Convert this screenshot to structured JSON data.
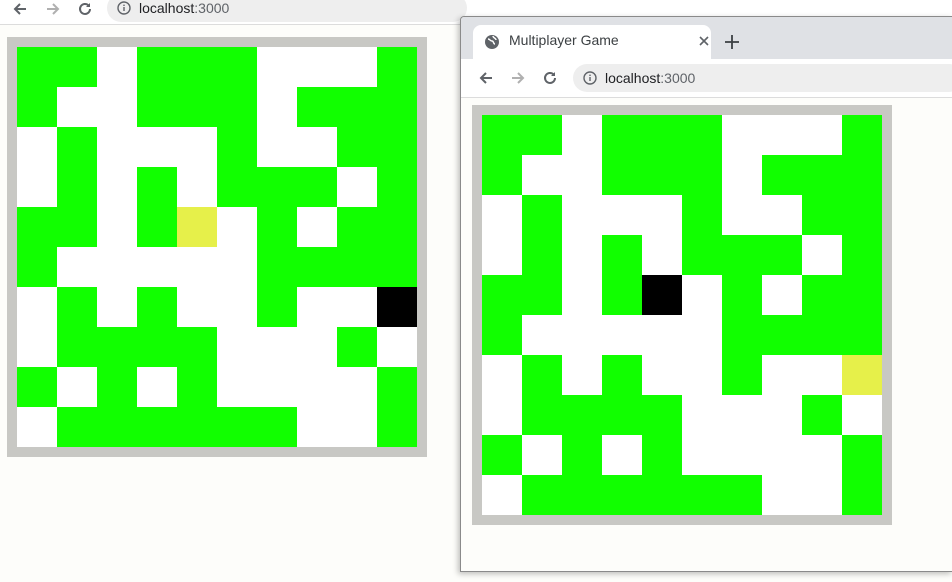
{
  "left_window": {
    "url_host": "localhost",
    "url_port": ":3000",
    "grid_rows": [
      "GGWGGGWWWG",
      "GWWGGGWGGG",
      "WGWWWGWWGG",
      "WGWGWGGGWG",
      "GGWGYWGWGG",
      "GWWWWWGGGG",
      "WGWGWWGWWK",
      "WGGGGWWWGW",
      "GWGWGWWWWG",
      "WGGGGGGWWG"
    ]
  },
  "right_window": {
    "tab_title": "Multiplayer Game",
    "url_host": "localhost",
    "url_port": ":3000",
    "grid_rows": [
      "GGWGGGWWWG",
      "GWWGGGWGGG",
      "WGWWWGWWGG",
      "WGWGWGGGWG",
      "GGWGKWGWGG",
      "GWWWWWGGGG",
      "WGWGWWGWWY",
      "WGGGGWWWGW",
      "GWGWGWWWWG",
      "WGGGGGGWWG"
    ]
  },
  "colors": {
    "wall": "#11ff00",
    "floor": "#ffffff",
    "player_yellow": "#e6f04a",
    "player_black": "#000000",
    "board_border": "#c8c8c4"
  },
  "icons": [
    "back-arrow-icon",
    "forward-arrow-icon",
    "reload-icon",
    "info-icon",
    "globe-icon",
    "close-icon",
    "plus-icon"
  ]
}
